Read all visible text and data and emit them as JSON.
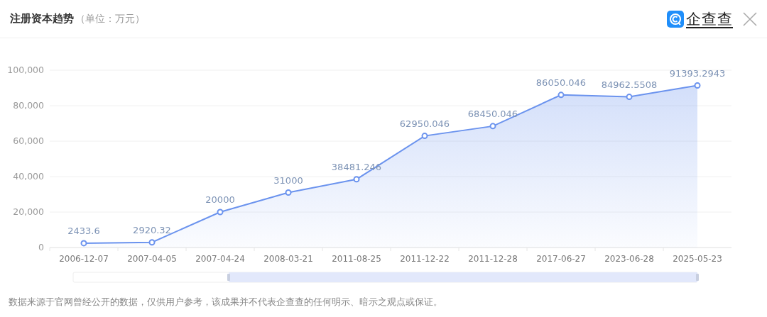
{
  "header": {
    "title": "注册资本趋势",
    "unit": "（单位：万元）",
    "logo_text": "企查查"
  },
  "chart": {
    "chart_data": {
      "type": "area",
      "categories": [
        "2006-12-07",
        "2007-04-05",
        "2007-04-24",
        "2008-03-21",
        "2011-08-25",
        "2011-12-22",
        "2011-12-28",
        "2017-06-27",
        "2023-06-28",
        "2025-05-23"
      ],
      "series": [
        {
          "color": "#6b93ee",
          "values": [
            2433.6,
            2920.32,
            20000,
            31000,
            38481.246,
            62950.046,
            68450.046,
            86050.046,
            84962.5508,
            91393.2943
          ]
        }
      ],
      "ylim": [
        0,
        100000
      ],
      "yticks": [
        0,
        {
          "value": 20000,
          "label": "20,000"
        },
        {
          "value": 40000,
          "label": "40,000"
        },
        {
          "value": 60000,
          "label": "60,000"
        },
        {
          "value": 80000,
          "label": "80,000"
        },
        {
          "value": 100000,
          "label": "100,000"
        }
      ],
      "grid": true,
      "data_labels": true
    }
  },
  "footer": {
    "note": "数据来源于官网曾经公开的数据，仅供用户参考，该成果并不代表企查查的任何明示、暗示之观点或保证。"
  }
}
